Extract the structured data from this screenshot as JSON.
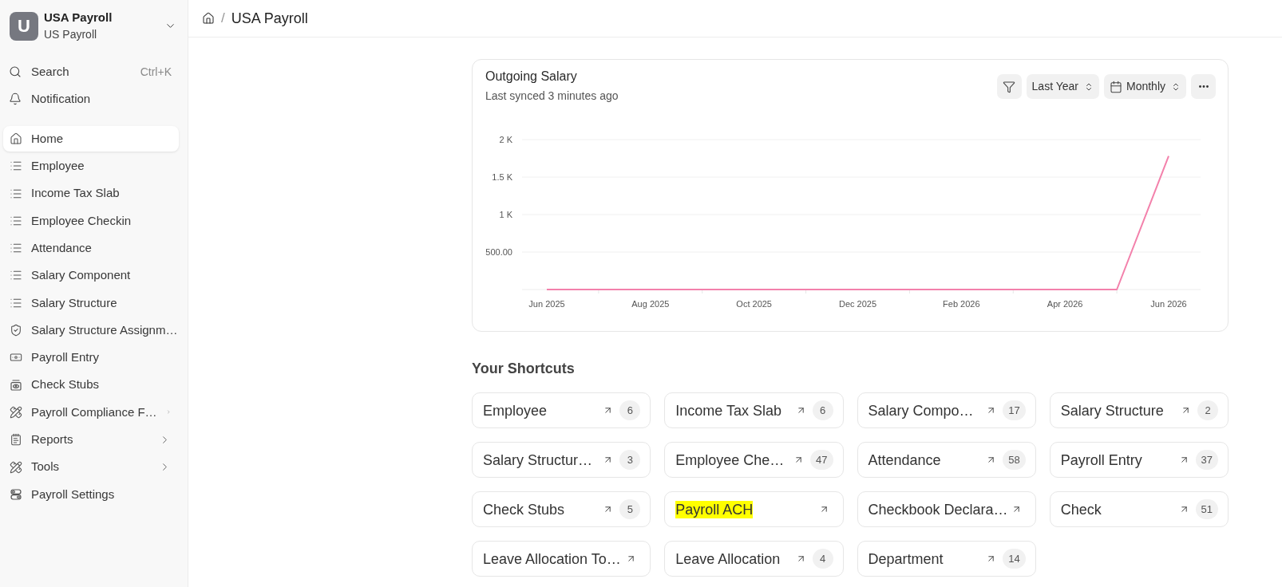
{
  "sidebar": {
    "workspace": {
      "initial": "U",
      "name": "USA Payroll",
      "subtitle": "US Payroll"
    },
    "search": {
      "label": "Search",
      "shortcut": "Ctrl+K"
    },
    "notification": {
      "label": "Notification"
    },
    "items": [
      {
        "label": "Home",
        "kind": "link",
        "selected": true
      },
      {
        "label": "Employee",
        "kind": "link",
        "selected": false
      },
      {
        "label": "Income Tax Slab",
        "kind": "link",
        "selected": false
      },
      {
        "label": "Employee Checkin",
        "kind": "link",
        "selected": false
      },
      {
        "label": "Attendance",
        "kind": "link",
        "selected": false
      },
      {
        "label": "Salary Component",
        "kind": "link",
        "selected": false
      },
      {
        "label": "Salary Structure",
        "kind": "link",
        "selected": false
      },
      {
        "label": "Salary Structure Assignm…",
        "kind": "link",
        "selected": false
      },
      {
        "label": "Payroll Entry",
        "kind": "link",
        "selected": false
      },
      {
        "label": "Check Stubs",
        "kind": "link",
        "selected": false
      },
      {
        "label": "Payroll Compliance F…",
        "kind": "group",
        "expanded": false,
        "selected": false
      },
      {
        "label": "Reports",
        "kind": "group",
        "expanded": false,
        "selected": false
      },
      {
        "label": "Tools",
        "kind": "group",
        "expanded": false,
        "selected": false
      },
      {
        "label": "Payroll Settings",
        "kind": "link",
        "selected": false
      }
    ]
  },
  "breadcrumb": {
    "separator": "/",
    "title": "USA Payroll"
  },
  "chart_card": {
    "subtitle": "Last synced 3 minutes ago",
    "range": "Last Year",
    "interval": "Monthly",
    "chart_data": {
      "type": "line",
      "title": "Outgoing Salary",
      "categories": [
        "Jun 2025",
        null,
        "Aug 2025",
        null,
        "Oct 2025",
        null,
        "Dec 2025",
        null,
        "Feb 2026",
        null,
        "Apr 2026",
        null,
        "Jun 2026"
      ],
      "series": [
        {
          "color": "#f381ab",
          "values": [
            0,
            0,
            0,
            0,
            0,
            0,
            0,
            0,
            0,
            0,
            0,
            0,
            1780
          ]
        }
      ],
      "ylim": [
        0,
        2000
      ],
      "yticks": [
        {
          "value": 500,
          "label": "500.00"
        },
        {
          "value": 1000,
          "label": "1 K"
        },
        {
          "value": 1500,
          "label": "1.5 K"
        },
        {
          "value": 2000,
          "label": "2 K"
        }
      ],
      "grid": true
    }
  },
  "shortcuts": {
    "title": "Your Shortcuts",
    "items": [
      {
        "label": "Employee",
        "count": "6",
        "highlighted": false
      },
      {
        "label": "Income Tax Slab",
        "count": "6",
        "highlighted": false
      },
      {
        "label": "Salary Compo…",
        "count": "17",
        "highlighted": false
      },
      {
        "label": "Salary Structure",
        "count": "2",
        "highlighted": false
      },
      {
        "label": "Salary Structur…",
        "count": "3",
        "highlighted": false
      },
      {
        "label": "Employee Che…",
        "count": "47",
        "highlighted": false
      },
      {
        "label": "Attendance",
        "count": "58",
        "highlighted": false
      },
      {
        "label": "Payroll Entry",
        "count": "37",
        "highlighted": false
      },
      {
        "label": "Check Stubs",
        "count": "5",
        "highlighted": false
      },
      {
        "label": "Payroll ACH",
        "highlighted": true
      },
      {
        "label": "Checkbook Declara…",
        "highlighted": false
      },
      {
        "label": "Check",
        "count": "51",
        "highlighted": false
      },
      {
        "label": "Leave Allocation To…",
        "highlighted": false
      },
      {
        "label": "Leave Allocation",
        "count": "4",
        "highlighted": false
      },
      {
        "label": "Department",
        "count": "14",
        "highlighted": false
      }
    ]
  }
}
